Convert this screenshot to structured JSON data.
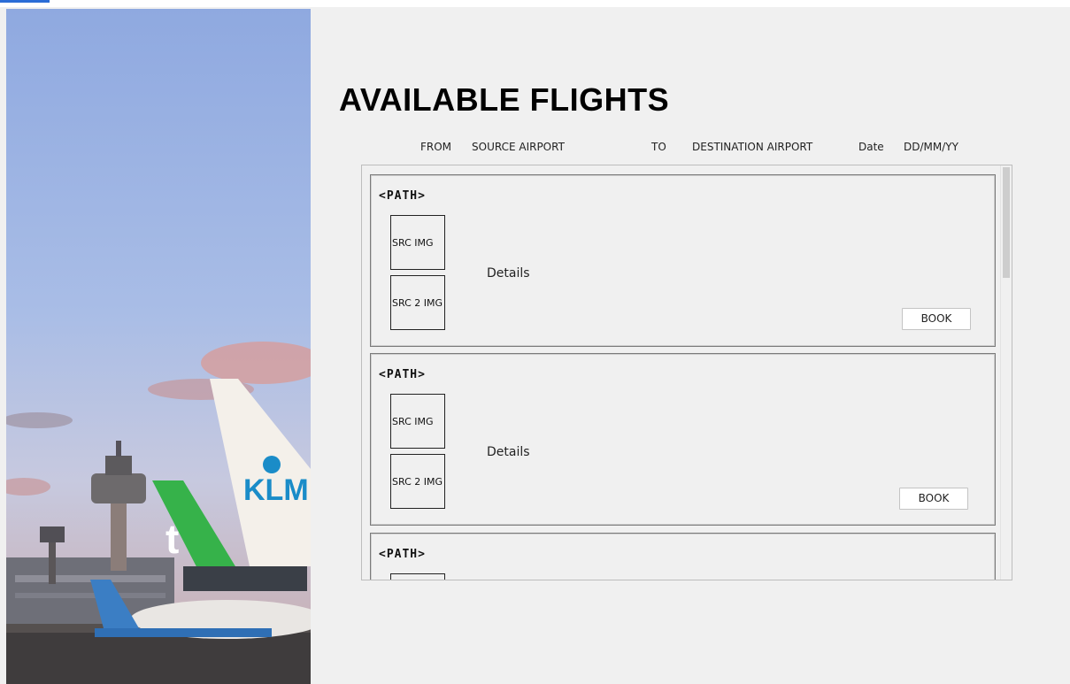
{
  "title": "AVAILABLE FLIGHTS",
  "search": {
    "from_label": "FROM",
    "source_value": "SOURCE AIRPORT",
    "to_label": "TO",
    "destination_value": "DESTINATION AIRPORT",
    "date_label": "Date",
    "date_value": "DD/MM/YY"
  },
  "flights": [
    {
      "path": "<PATH>",
      "src_img": "SRC IMG",
      "src2_img": "SRC 2 IMG",
      "details": "Details",
      "book": "BOOK"
    },
    {
      "path": "<PATH>",
      "src_img": "SRC IMG",
      "src2_img": "SRC 2 IMG",
      "details": "Details",
      "book": "BOOK"
    },
    {
      "path": "<PATH>"
    }
  ],
  "photo": {
    "tail_logo": "KLM",
    "tail_logo_2": "t"
  }
}
